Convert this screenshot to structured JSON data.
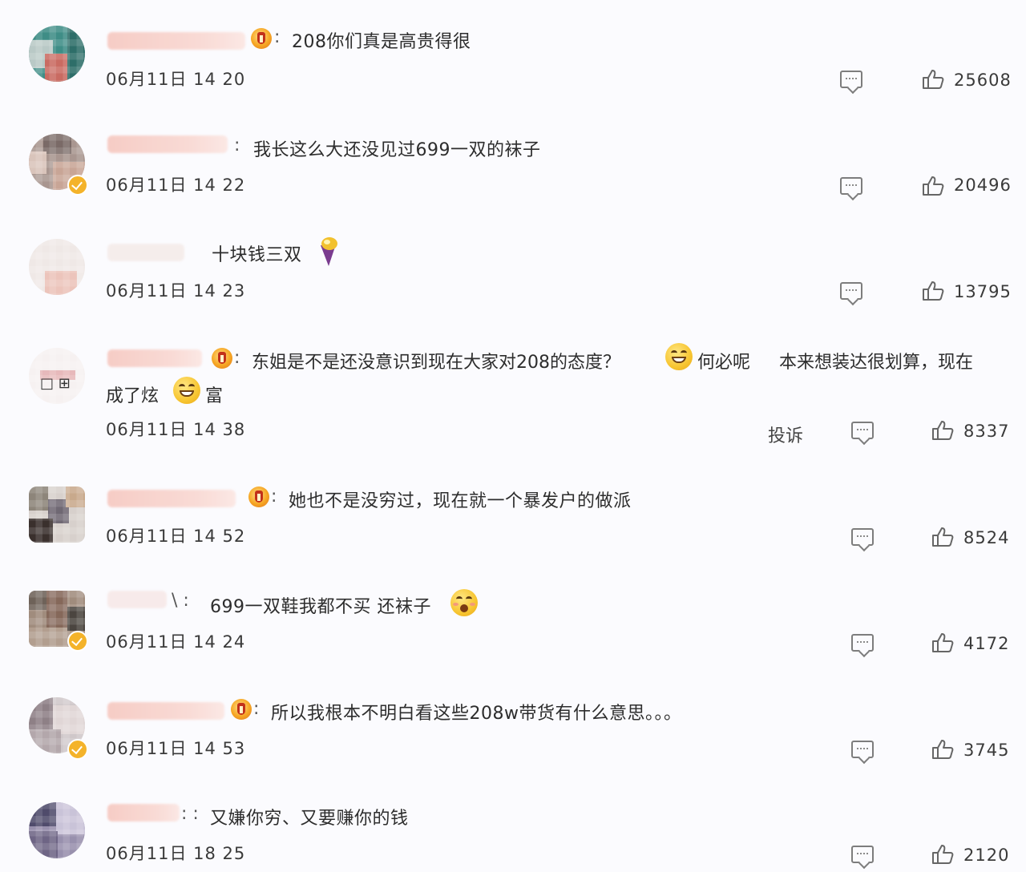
{
  "comments": [
    {
      "text": "208你们真是高贵得很",
      "date": "06月11日 14 20",
      "likes": "25608"
    },
    {
      "text": "我长这么大还没见过699一双的袜子",
      "date": "06月11日 14 22",
      "likes": "20496"
    },
    {
      "text": "十块钱三双",
      "date": "06月11日 14 23",
      "likes": "13795"
    },
    {
      "text": "东姐是不是还没意识到现在大家对208的态度？",
      "text_b": "何必呢",
      "text_c": "本来想装达很划算，现在",
      "text_line2": "成了炫",
      "text_line2_end": "富",
      "date": "06月11日 14 38",
      "report": "投诉",
      "likes": "8337"
    },
    {
      "text": "她也不是没穷过，现在就一个暴发户的做派",
      "date": "06月11日 14 52",
      "likes": "8524"
    },
    {
      "text": "699一双鞋我都不买 还袜子",
      "date": "06月11日 14 24",
      "likes": "4172"
    },
    {
      "text": "所以我根本不明白看这些208w带货有什么意思。。。",
      "date": "06月11日 14 53",
      "likes": "3745"
    },
    {
      "text": "又嫌你穷、又要赚你的钱",
      "date": "06月11日 18 25",
      "likes": "2120"
    }
  ],
  "colon": ":",
  "icons": {
    "reply": "comment-icon",
    "like": "thumbs-up-icon",
    "fan": "fan-badge-icon",
    "verified": "verified-badge-icon"
  }
}
